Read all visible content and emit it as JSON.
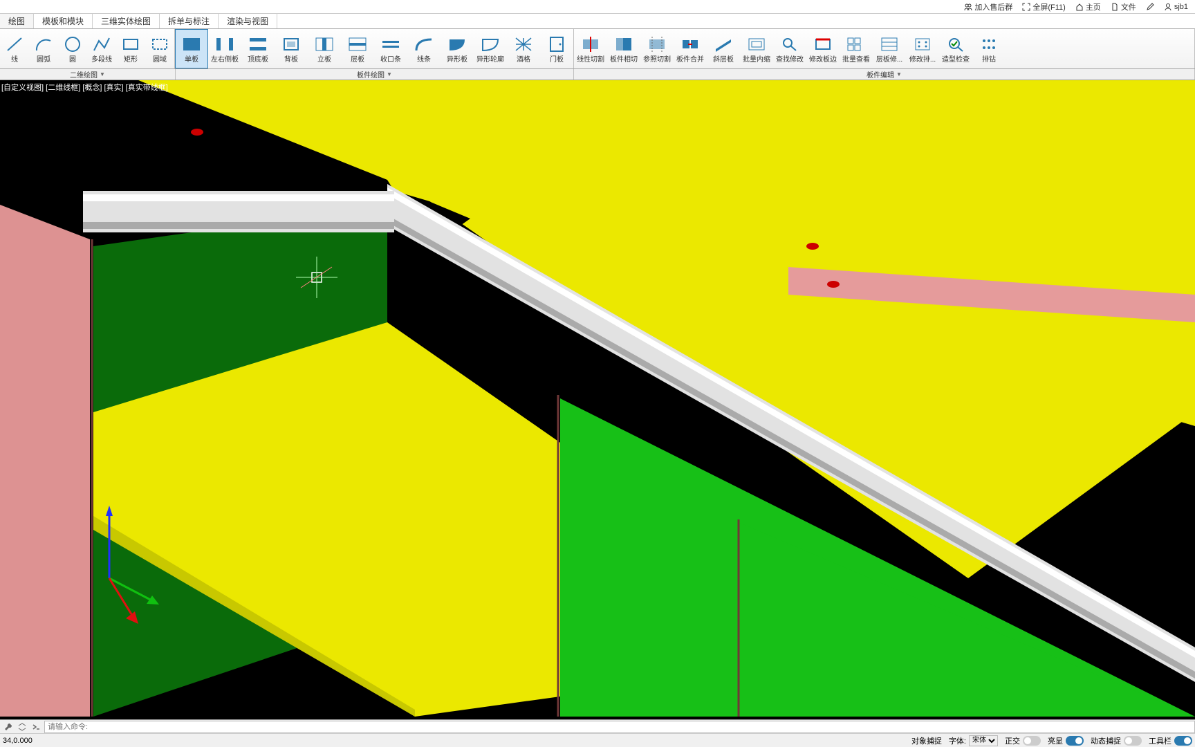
{
  "titlebar": {
    "join_group": "加入售后群",
    "fullscreen": "全屏(F11)",
    "home": "主页",
    "file": "文件",
    "user": "sjb1"
  },
  "tabs": [
    {
      "label": "绘图",
      "active": true
    },
    {
      "label": "模板和模块"
    },
    {
      "label": "三维实体绘图"
    },
    {
      "label": "拆单与标注"
    },
    {
      "label": "渲染与视图"
    }
  ],
  "ribbon": {
    "g1": [
      {
        "label": "线"
      },
      {
        "label": "圆弧"
      },
      {
        "label": "圆"
      },
      {
        "label": "多段线"
      },
      {
        "label": "矩形"
      },
      {
        "label": "圆域"
      }
    ],
    "g2": [
      {
        "label": "单板",
        "sel": true
      },
      {
        "label": "左右侧板"
      },
      {
        "label": "顶底板"
      },
      {
        "label": "背板"
      },
      {
        "label": "立板"
      },
      {
        "label": "层板"
      },
      {
        "label": "收口条"
      },
      {
        "label": "线条"
      },
      {
        "label": "异形板"
      },
      {
        "label": "异形轮廓"
      },
      {
        "label": "酒格"
      },
      {
        "label": "门板"
      }
    ],
    "g3": [
      {
        "label": "线性切割"
      },
      {
        "label": "板件相切"
      },
      {
        "label": "参照切割"
      },
      {
        "label": "板件合并"
      },
      {
        "label": "斜层板"
      },
      {
        "label": "批量内缩"
      },
      {
        "label": "查找修改"
      },
      {
        "label": "修改板边"
      },
      {
        "label": "批量查看"
      },
      {
        "label": "层板修..."
      },
      {
        "label": "修改排..."
      },
      {
        "label": "造型检查"
      },
      {
        "label": "排钻"
      }
    ]
  },
  "panel_titles": {
    "p1": "二维绘图",
    "p2": "板件绘图",
    "p3": "板件编辑"
  },
  "viewport": {
    "label": "[自定义视图] [二维线框] [概念] [真实] [真实带线框]"
  },
  "cmd": {
    "coords": "34,0.000",
    "placeholder": "请输入命令:"
  },
  "status": {
    "snap": "对象捕捉",
    "font_label": "字体:",
    "font_value": "宋体",
    "ortho": "正交",
    "highlight": "亮显",
    "dyncatch": "动态捕捉",
    "toolbar": "工具栏"
  }
}
